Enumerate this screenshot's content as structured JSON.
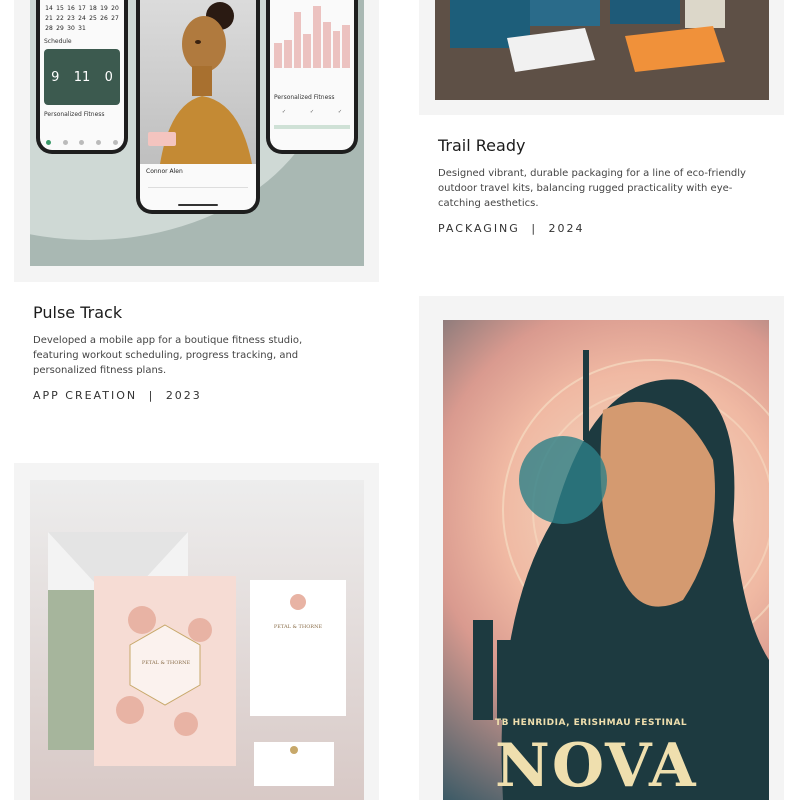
{
  "projects": [
    {
      "title": "Pulse Track",
      "description": "Developed a mobile app for a boutique fitness studio, featuring workout scheduling, progress tracking, and personalized fitness plans.",
      "category": "APP CREATION",
      "separator": "|",
      "year": "2023",
      "mockup": {
        "calendar_rows": [
          [
            "14",
            "15",
            "16",
            "17",
            "18",
            "19",
            "20"
          ],
          [
            "21",
            "22",
            "23",
            "24",
            "25",
            "26",
            "27"
          ],
          [
            "28",
            "29",
            "30",
            "31",
            "",
            "",
            ""
          ]
        ],
        "schedule_label": "Schedule",
        "schedule_values": [
          "9",
          "11",
          "0"
        ],
        "fitness_label": "Personalized Fitness",
        "portrait_caption": "Connor Alen",
        "chart_values": [
          0.4,
          0.45,
          0.9,
          0.55,
          1.0,
          0.75,
          0.6,
          0.7
        ]
      }
    },
    {
      "title": "Trail Ready",
      "description": "Designed vibrant, durable packaging for a line of eco-friendly outdoor travel kits, balancing rugged practicality with eye-catching aesthetics.",
      "category": "PACKAGING",
      "separator": "|",
      "year": "2024"
    },
    {
      "title": "Petal & Thorne",
      "card_text": "PETAL & THORNE"
    },
    {
      "title": "NOVA",
      "poster_subtitle": "TB HENRIDIA, ERISHMAU FESTINAL",
      "poster_title": "NOVA"
    }
  ],
  "colors": {
    "card_bg": "#f4f4f4",
    "schedule_green": "#3c5a4f",
    "bar_pink": "#ecc2c0",
    "nova_cream": "#efdfae"
  }
}
